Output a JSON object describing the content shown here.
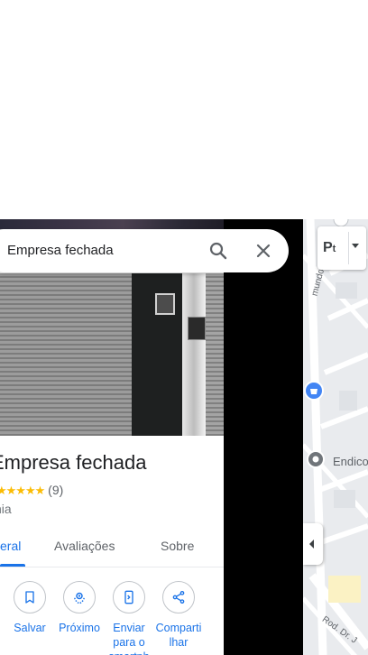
{
  "search": {
    "value": "Empresa fechada"
  },
  "place": {
    "title": "Empresa fechada",
    "rating_stars": "★★★★★",
    "review_count": "(9)",
    "category": "nia"
  },
  "tabs": [
    {
      "label": "eral",
      "active": true
    },
    {
      "label": "Avaliações",
      "active": false
    },
    {
      "label": "Sobre",
      "active": false
    }
  ],
  "actions": [
    {
      "label": "Salvar",
      "icon": "bookmark-icon"
    },
    {
      "label": "Próximo",
      "icon": "nearby-icon"
    },
    {
      "label": "Enviar para o smartph",
      "icon": "send-to-phone-icon"
    },
    {
      "label": "Comparti lhar",
      "icon": "share-icon"
    }
  ],
  "map": {
    "layer_label": "P",
    "layer_sub": "t",
    "place_label": "Endico",
    "street_label_1": "mundo P",
    "street_label_2": "Rod. Dr. J"
  },
  "colors": {
    "accent": "#1a73e8",
    "star": "#fbbc04",
    "map_bg": "#e9ebee",
    "pin_blue": "#4285f4"
  }
}
